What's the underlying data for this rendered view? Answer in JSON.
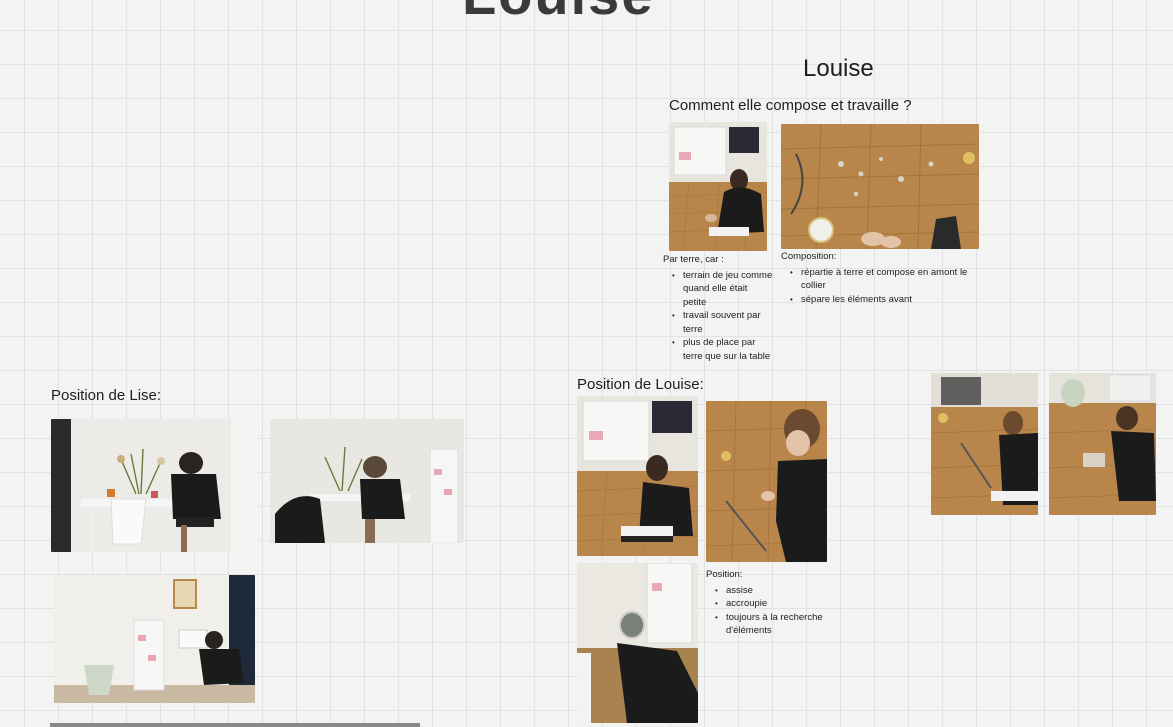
{
  "board": {
    "top_heading": "Louise",
    "louise_title": "Louise",
    "compose_question": "Comment elle compose et travaille ?",
    "lise_position_title": "Position de Lise:",
    "louise_position_title": "Position de Louise:"
  },
  "notes": {
    "floor": {
      "heading": "Par terre, car :",
      "items": [
        "terrain de jeu comme quand elle était petite",
        "travail souvent par terre",
        "plus de place par terre que sur la table"
      ]
    },
    "composition": {
      "heading": "Composition:",
      "items": [
        "répartie à terre et compose en amont le collier",
        "sépare les éléments avant"
      ]
    },
    "position": {
      "heading": "Position:",
      "items": [
        "assise",
        "accroupie",
        "toujours à la recherche d'éléments"
      ]
    }
  },
  "colors": {
    "parquet": "#b8864a",
    "wall": "#ece9e4",
    "black_clothing": "#1b1b1b"
  }
}
